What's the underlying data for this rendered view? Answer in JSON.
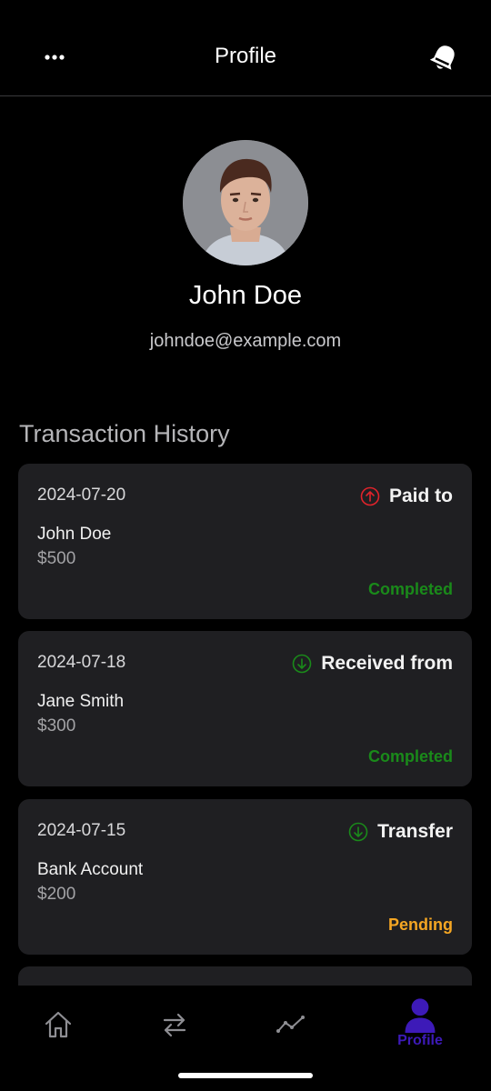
{
  "header": {
    "title": "Profile",
    "menu_icon": "more-horizontal-icon",
    "bell_icon": "bell-icon"
  },
  "profile": {
    "name": "John Doe",
    "email": "johndoe@example.com"
  },
  "section_title": "Transaction History",
  "transactions": [
    {
      "date": "2024-07-20",
      "type": "Paid to",
      "direction": "up",
      "party": "John Doe",
      "amount": "$500",
      "status": "Completed"
    },
    {
      "date": "2024-07-18",
      "type": "Received from",
      "direction": "down",
      "party": "Jane Smith",
      "amount": "$300",
      "status": "Completed"
    },
    {
      "date": "2024-07-15",
      "type": "Transfer",
      "direction": "down",
      "party": "Bank Account",
      "amount": "$200",
      "status": "Pending"
    }
  ],
  "nav": {
    "items": [
      {
        "icon": "home-icon",
        "label": ""
      },
      {
        "icon": "transfer-arrows-icon",
        "label": ""
      },
      {
        "icon": "analytics-icon",
        "label": ""
      },
      {
        "icon": "user-icon",
        "label": "Profile"
      }
    ],
    "active_color": "#3d1ab8"
  },
  "colors": {
    "completed": "#1a8a1a",
    "pending": "#f5a623",
    "paid_icon": "#e0232b",
    "received_icon": "#1a8a1a"
  }
}
